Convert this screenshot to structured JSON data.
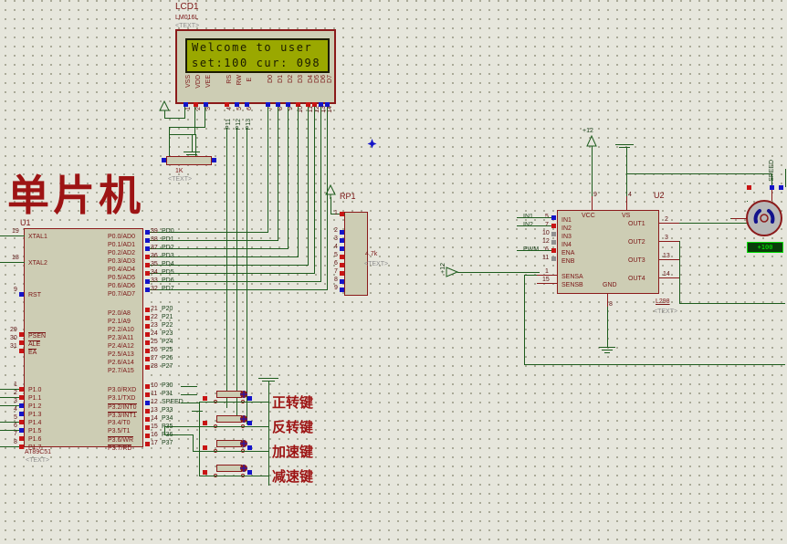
{
  "app": {
    "type": "proteus-schematic",
    "background_color": "#e6e6dc",
    "wire_color": "#1d5c1d",
    "body_color": "#cdcdb4",
    "outline_color": "#8b1a1a"
  },
  "title_text": "单片机",
  "lcd": {
    "ref": "LCD1",
    "part": "LM016L",
    "text_tag": "<TEXT>",
    "line1": "Welcome to user",
    "line2": "set:100 cur: 098",
    "pins": [
      "VSS",
      "VDD",
      "VEE",
      "RS",
      "RW",
      "E",
      "D0",
      "D1",
      "D2",
      "D3",
      "D4",
      "D5",
      "D6",
      "D7"
    ],
    "pin_numbers": [
      "1",
      "2",
      "3",
      "4",
      "5",
      "6",
      "7",
      "8",
      "9",
      "10",
      "11",
      "12",
      "13",
      "14"
    ],
    "net_labels": [
      "P11",
      "P12",
      "P13"
    ]
  },
  "contrast_resistor": {
    "value": "1K",
    "text_tag": "<TEXT>"
  },
  "u1": {
    "ref": "U1",
    "part": "AT89C51",
    "text_tag": "<TEXT>",
    "left_pins": [
      {
        "num": "19",
        "name": "XTAL1"
      },
      {
        "num": "18",
        "name": "XTAL2"
      },
      {
        "num": "9",
        "name": "RST"
      },
      {
        "num": "29",
        "name": "PSEN"
      },
      {
        "num": "30",
        "name": "ALE"
      },
      {
        "num": "31",
        "name": "EA"
      },
      {
        "num": "1",
        "name": "P1.0"
      },
      {
        "num": "2",
        "name": "P1.1"
      },
      {
        "num": "3",
        "name": "P1.2"
      },
      {
        "num": "4",
        "name": "P1.3"
      },
      {
        "num": "5",
        "name": "P1.4"
      },
      {
        "num": "6",
        "name": "P1.5"
      },
      {
        "num": "7",
        "name": "P1.6"
      },
      {
        "num": "8",
        "name": "P1.7"
      }
    ],
    "right_p0": [
      {
        "num": "39",
        "name": "P0.0/AD0",
        "net": "PD0"
      },
      {
        "num": "38",
        "name": "P0.1/AD1",
        "net": "PD1"
      },
      {
        "num": "37",
        "name": "P0.2/AD2",
        "net": "PD2"
      },
      {
        "num": "36",
        "name": "P0.3/AD3",
        "net": "PD3"
      },
      {
        "num": "35",
        "name": "P0.4/AD4",
        "net": "PD4"
      },
      {
        "num": "34",
        "name": "P0.5/AD5",
        "net": "PD5"
      },
      {
        "num": "33",
        "name": "P0.6/AD6",
        "net": "PD6"
      },
      {
        "num": "32",
        "name": "P0.7/AD7",
        "net": "PD7"
      }
    ],
    "right_p2": [
      {
        "num": "21",
        "name": "P2.0/A8",
        "net": "P20"
      },
      {
        "num": "22",
        "name": "P2.1/A9",
        "net": "P21"
      },
      {
        "num": "23",
        "name": "P2.2/A10",
        "net": "P22"
      },
      {
        "num": "24",
        "name": "P2.3/A11",
        "net": "P23"
      },
      {
        "num": "25",
        "name": "P2.4/A12",
        "net": "P24"
      },
      {
        "num": "26",
        "name": "P2.5/A13",
        "net": "P25"
      },
      {
        "num": "27",
        "name": "P2.6/A14",
        "net": "P26"
      },
      {
        "num": "28",
        "name": "P2.7/A15",
        "net": "P27"
      }
    ],
    "right_p3": [
      {
        "num": "10",
        "name": "P3.0/RXD",
        "net": "P30"
      },
      {
        "num": "11",
        "name": "P3.1/TXD",
        "net": "P31"
      },
      {
        "num": "12",
        "name": "P3.2/INT0",
        "net": "SPEED"
      },
      {
        "num": "13",
        "name": "P3.3/INT1",
        "net": "P33"
      },
      {
        "num": "14",
        "name": "P3.4/T0",
        "net": "P34"
      },
      {
        "num": "15",
        "name": "P3.5/T1",
        "net": "P35"
      },
      {
        "num": "16",
        "name": "P3.6/WR",
        "net": "P36"
      },
      {
        "num": "17",
        "name": "P3.7/RD",
        "net": "P37"
      }
    ]
  },
  "rp1": {
    "ref": "RP1",
    "value": "4.7k",
    "text_tag": "<TEXT>",
    "pin_numbers": [
      "1",
      "2",
      "3",
      "4",
      "5",
      "6",
      "7",
      "8",
      "9"
    ]
  },
  "u2": {
    "ref": "U2",
    "part": "L298",
    "text_tag": "<TEXT>",
    "left_pins": [
      {
        "num": "5",
        "name": "IN1",
        "net": "IN1"
      },
      {
        "num": "7",
        "name": "IN2",
        "net": "IN2"
      },
      {
        "num": "10",
        "name": "IN3",
        "net": ""
      },
      {
        "num": "12",
        "name": "IN4",
        "net": ""
      },
      {
        "num": "6",
        "name": "ENA",
        "net": "PWM"
      },
      {
        "num": "11",
        "name": "ENB",
        "net": ""
      },
      {
        "num": "1",
        "name": "SENSA",
        "net": ""
      },
      {
        "num": "15",
        "name": "SENSB",
        "net": ""
      }
    ],
    "right_pins": [
      {
        "num": "2",
        "name": "OUT1"
      },
      {
        "num": "3",
        "name": "OUT2"
      },
      {
        "num": "13",
        "name": "OUT3"
      },
      {
        "num": "14",
        "name": "OUT4"
      }
    ],
    "top_pins": [
      {
        "num": "9",
        "name": "VCC"
      },
      {
        "num": "4",
        "name": "VS"
      }
    ],
    "bottom_pin": {
      "num": "8",
      "name": "GND"
    }
  },
  "power": {
    "vcc_label": "+12",
    "vcc_label_2": "+12"
  },
  "motor": {
    "net_label": "SPEED",
    "readout": "+100"
  },
  "buttons": [
    {
      "label": "正转键",
      "meaning": "forward-key"
    },
    {
      "label": "反转键",
      "meaning": "reverse-key"
    },
    {
      "label": "加速键",
      "meaning": "accelerate-key"
    },
    {
      "label": "减速键",
      "meaning": "decelerate-key"
    }
  ]
}
